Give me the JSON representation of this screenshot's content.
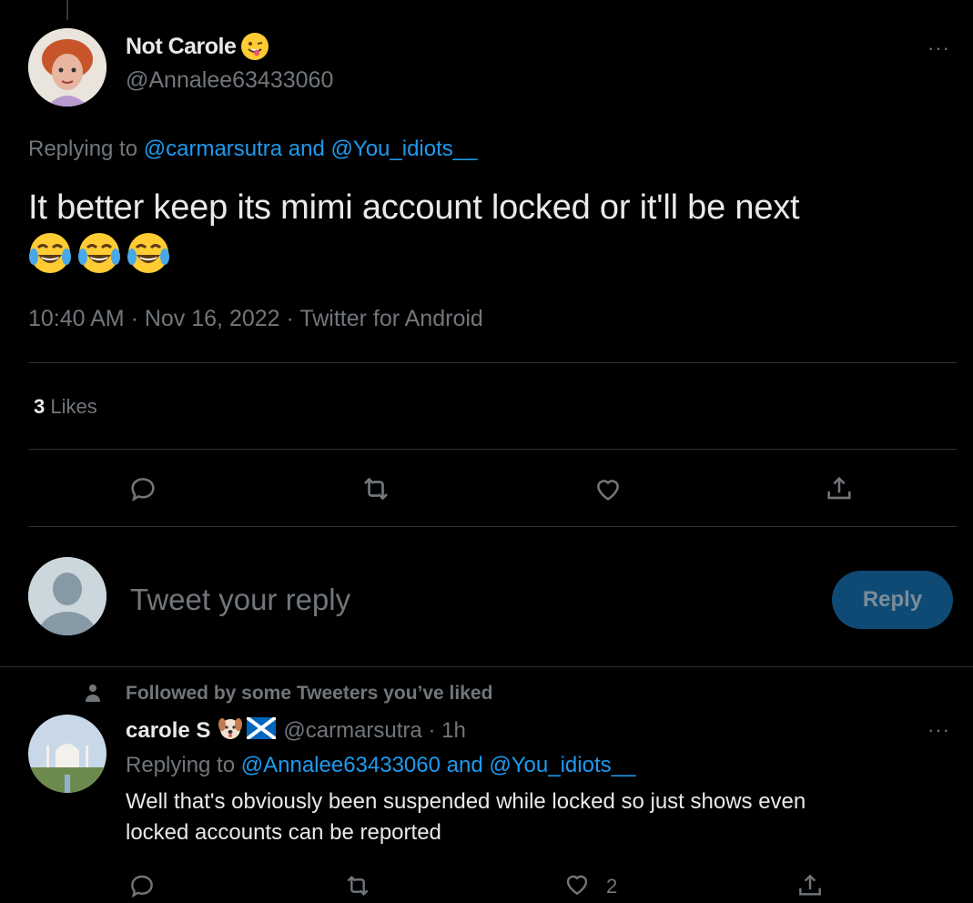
{
  "tweet": {
    "display_name": "Not Carole",
    "handle": "@Annalee63433060",
    "more": "···",
    "replying_prefix": "Replying to ",
    "replying_to_1": "@carmarsutra",
    "replying_and": " and ",
    "replying_to_2": "@You_idiots__",
    "text": "It better keep its mimi account locked or it'll be next",
    "emoji_name": "winking-face-with-tongue-icon",
    "laugh_emoji_count_icons": [
      "face-with-tears-of-joy-icon",
      "face-with-tears-of-joy-icon",
      "face-with-tears-of-joy-icon"
    ],
    "timestamp": "10:40 AM · Nov 16, 2022 · Twitter for Android",
    "likes_count": "3",
    "likes_label": " Likes"
  },
  "composer": {
    "placeholder": "Tweet your reply",
    "button_label": "Reply"
  },
  "reply": {
    "social_context": "Followed by some Tweeters you’ve liked",
    "display_name": "carole S",
    "handle_time": "@carmarsutra · 1h",
    "more": "···",
    "replying_prefix": "Replying to ",
    "replying_to_1": "@Annalee63433060",
    "replying_and": " and ",
    "replying_to_2": "@You_idiots__",
    "text_line1": "Well that's obviously been suspended while locked so just shows even",
    "text_line2": "locked accounts can be reported",
    "like_count": "2"
  },
  "colors": {
    "background": "#000000",
    "text": "#e7e9ea",
    "secondary": "#71767b",
    "link": "#1d9bf0",
    "reply_button": "#0e4a73"
  }
}
